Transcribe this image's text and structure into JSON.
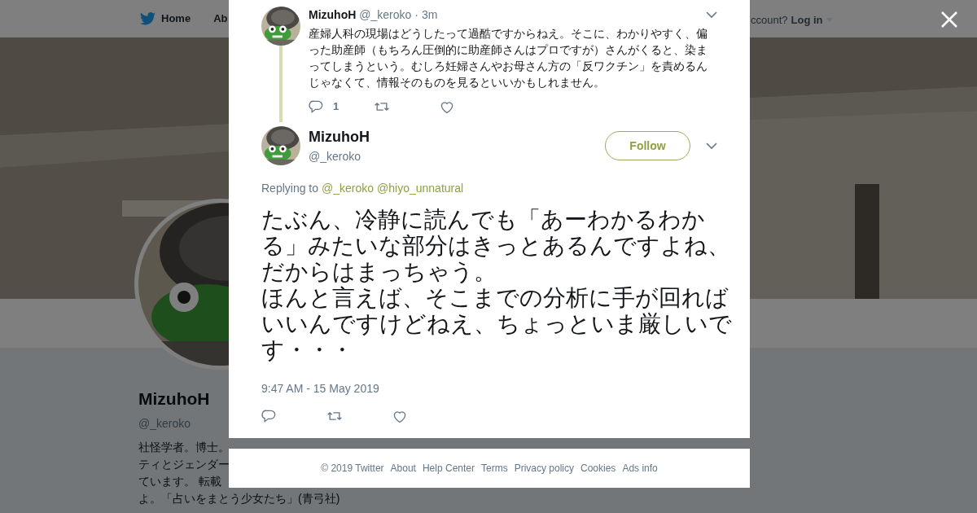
{
  "nav": {
    "items": [
      {
        "label": "Home"
      },
      {
        "label": "Ab"
      }
    ],
    "account_prompt": "ccount?",
    "login": "Log in"
  },
  "profile": {
    "name": "MizuhoH",
    "handle": "@_keroko",
    "bio_lines": [
      "社怪学者。博士。",
      "ティとジェンダー",
      "ています。 転載",
      "よ。「占いをまとう少女たち」(青弓社)"
    ]
  },
  "thread_tweet": {
    "name": "MizuhoH",
    "handle": "@_keroko",
    "time": "· 3m",
    "text": "産婦人科の現場はどうしたって過酷ですからねえ。そこに、わかりやすく、偏った助産師（もちろん圧倒的に助産師さんはプロですが）さんがくると、染まってしまうという。むしろ妊婦さんやお母さん方の「反ワクチン」を責めるんじゃなくて、情報そのものを見るといいかもしれません。",
    "reply_count": "1"
  },
  "tweet": {
    "name": "MizuhoH",
    "handle": "@_keroko",
    "follow": "Follow",
    "replying_label": "Replying to",
    "mentions": [
      "@_keroko",
      "@hiyo_unnatural"
    ],
    "paragraphs": [
      "たぶん、冷静に読んでも「あーわかるわかる」みたいな部分はきっとあるんですよね、だからはまっちゃう。",
      "ほんと言えば、そこまでの分析に手が回ればいいんですけどねえ、ちょっといま厳しいです・・・"
    ],
    "timestamp": "9:47 AM - 15 May 2019"
  },
  "footer": [
    "© 2019 Twitter",
    "About",
    "Help Center",
    "Terms",
    "Privacy policy",
    "Cookies",
    "Ads info"
  ]
}
